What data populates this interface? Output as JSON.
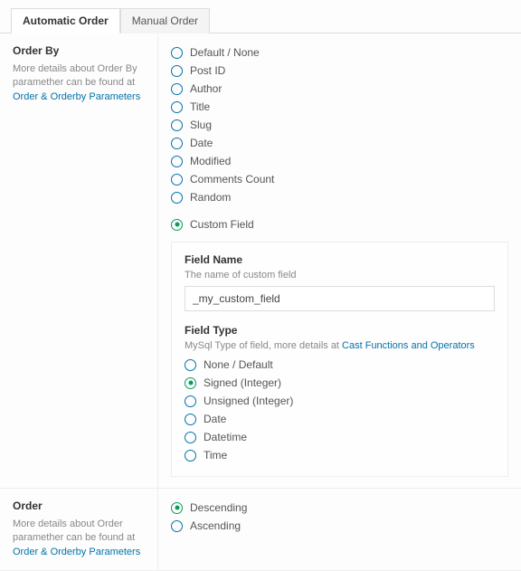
{
  "tabs": {
    "automatic": "Automatic Order",
    "manual": "Manual Order"
  },
  "orderby": {
    "title": "Order By",
    "desc": "More details about Order By paramether can be found at ",
    "link": "Order & Orderby Parameters",
    "options": {
      "default": "Default / None",
      "postid": "Post ID",
      "author": "Author",
      "title": "Title",
      "slug": "Slug",
      "date": "Date",
      "modified": "Modified",
      "comments": "Comments Count",
      "random": "Random",
      "custom": "Custom Field"
    },
    "fieldname": {
      "title": "Field Name",
      "desc": "The name of custom field",
      "value": "_my_custom_field"
    },
    "fieldtype": {
      "title": "Field Type",
      "desc": "MySql Type of field, more details at ",
      "link": "Cast Functions and Operators",
      "options": {
        "none": "None / Default",
        "signed": "Signed (Integer)",
        "unsigned": "Unsigned (Integer)",
        "date": "Date",
        "datetime": "Datetime",
        "time": "Time"
      }
    }
  },
  "order": {
    "title": "Order",
    "desc": "More details about Order paramether can be found at ",
    "link": "Order & Orderby Parameters",
    "options": {
      "desc": "Descending",
      "asc": "Ascending"
    }
  }
}
